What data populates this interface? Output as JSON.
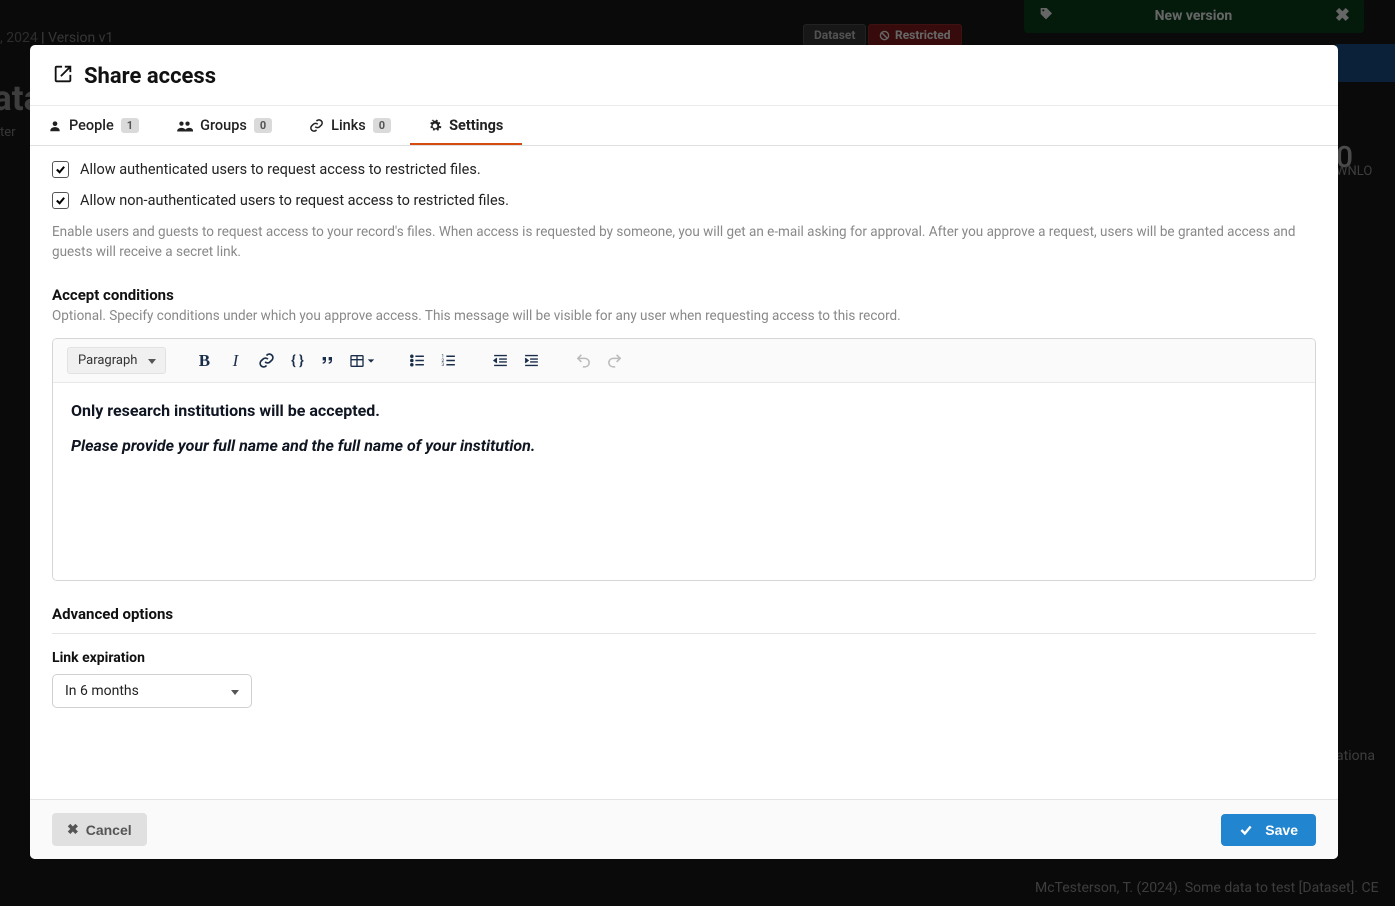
{
  "background": {
    "date_prefix": ", 2024",
    "version_separator": " | ",
    "version_text": "Version v1",
    "title_fragment": "ata",
    "subtitle_fragment": "ter",
    "dataset_badge": "Dataset",
    "restricted_badge": "Restricted",
    "new_version_label": "New version",
    "downloads_zero": "0",
    "downloads_label": "WNLO",
    "ation_label": "ationa",
    "citation_fragment": "McTesterson, T. (2024). Some data to test [Dataset]. CE"
  },
  "modal": {
    "title": "Share access",
    "tabs": {
      "people": {
        "label": "People",
        "count": "1"
      },
      "groups": {
        "label": "Groups",
        "count": "0"
      },
      "links": {
        "label": "Links",
        "count": "0"
      },
      "settings": {
        "label": "Settings"
      }
    },
    "settings": {
      "allow_auth_label": "Allow authenticated users to request access to restricted files.",
      "allow_guest_label": "Allow non-authenticated users to request access to restricted files.",
      "help_text": "Enable users and guests to request access to your record's files. When access is requested by someone, you will get an e-mail asking for approval. After you approve a request, users will be granted access and guests will receive a secret link.",
      "accept_heading": "Accept conditions",
      "accept_subtext": "Optional. Specify conditions under which you approve access. This message will be visible for any user when requesting access to this record.",
      "editor": {
        "format_label": "Paragraph",
        "content_line1": "Only research institutions will be accepted.",
        "content_line2": "Please provide your full name and the full name of your institution."
      },
      "advanced_heading": "Advanced options",
      "link_expiration_label": "Link expiration",
      "link_expiration_value": "In 6 months"
    },
    "footer": {
      "cancel": "Cancel",
      "save": "Save"
    }
  }
}
